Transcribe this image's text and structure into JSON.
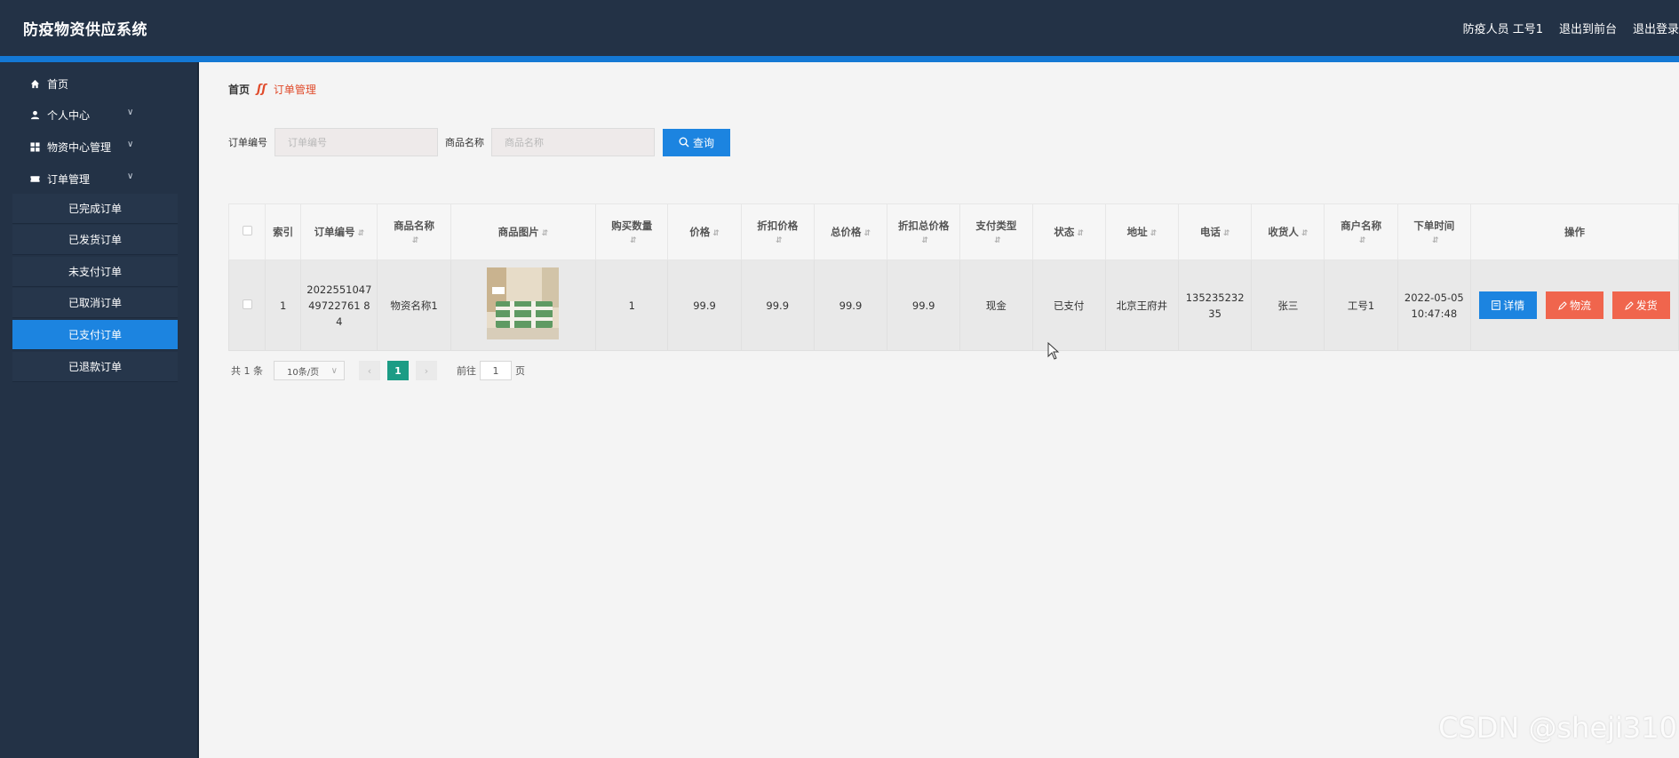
{
  "app": {
    "title": "防疫物资供应系统"
  },
  "header": {
    "user": "防疫人员 工号1",
    "front_link": "退出到前台",
    "logout": "退出登录"
  },
  "sidebar": {
    "items": [
      {
        "label": "首页",
        "icon": "home-icon"
      },
      {
        "label": "个人中心",
        "icon": "user-icon"
      },
      {
        "label": "物资中心管理",
        "icon": "grid-icon"
      },
      {
        "label": "订单管理",
        "icon": "ticket-icon"
      }
    ],
    "order_sub": [
      {
        "label": "已完成订单"
      },
      {
        "label": "已发货订单"
      },
      {
        "label": "未支付订单"
      },
      {
        "label": "已取消订单"
      },
      {
        "label": "已支付订单",
        "active": true
      },
      {
        "label": "已退款订单"
      }
    ]
  },
  "breadcrumb": {
    "home": "首页",
    "current": "订单管理"
  },
  "search": {
    "order_label": "订单编号",
    "order_placeholder": "订单编号",
    "name_label": "商品名称",
    "name_placeholder": "商品名称",
    "query_btn": "查询"
  },
  "table": {
    "headers": [
      "索引",
      "订单编号",
      "商品名称",
      "商品图片",
      "购买数量",
      "价格",
      "折扣价格",
      "总价格",
      "折扣总价格",
      "支付类型",
      "状态",
      "地址",
      "电话",
      "收货人",
      "商户名称",
      "下单时间",
      "操作"
    ],
    "rows": [
      {
        "index": "1",
        "order_no": "202255104749722761 84",
        "name": "物资名称1",
        "qty": "1",
        "price": "99.9",
        "discount_price": "99.9",
        "total": "99.9",
        "discount_total": "99.9",
        "pay_type": "现金",
        "status": "已支付",
        "address": "北京王府井",
        "phone": "13523523235",
        "receiver": "张三",
        "merchant": "工号1",
        "time": "2022-05-05 10:47:48"
      }
    ],
    "actions": {
      "detail": "详情",
      "logistics": "物流",
      "ship": "发货"
    }
  },
  "pager": {
    "total": "共 1 条",
    "page_size": "10条/页",
    "current": "1",
    "goto": "前往",
    "goto_value": "1",
    "page_unit": "页"
  },
  "watermark": "CSDN @sheji310",
  "colors": {
    "header": "#233246",
    "accent": "#1c84e0",
    "danger": "#f0654d",
    "pager_active": "#1c9c85"
  }
}
